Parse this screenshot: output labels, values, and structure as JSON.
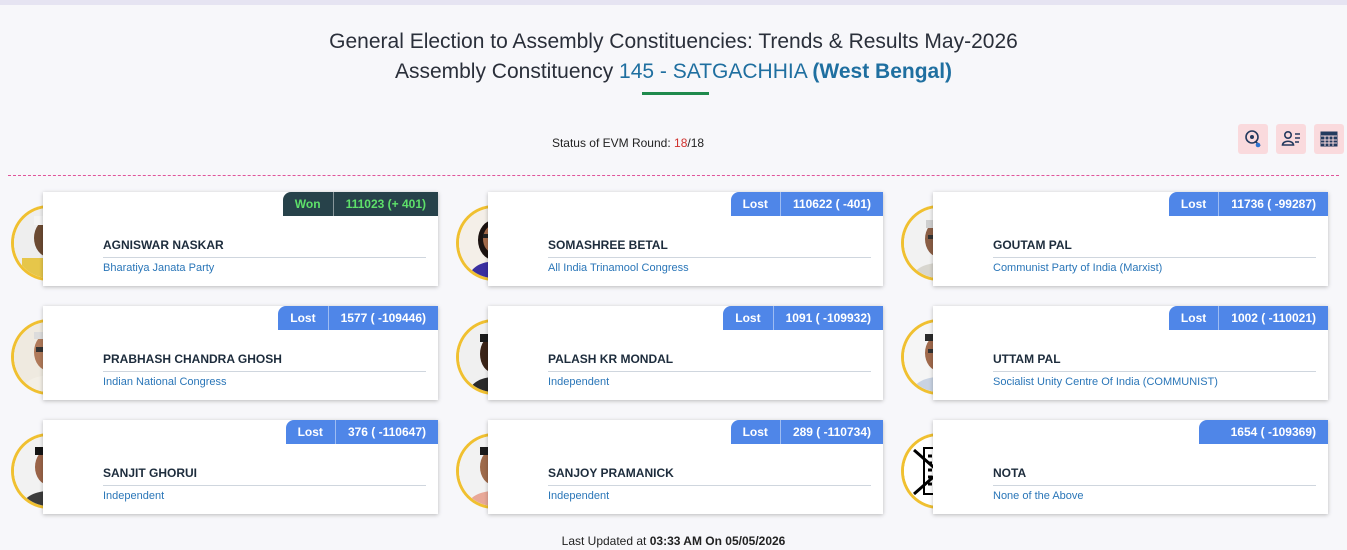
{
  "header": {
    "title_line1": "General Election to Assembly Constituencies: Trends & Results May-2026",
    "title_prefix": "Assembly Constituency",
    "constituency": "145 - SATGACHHIA",
    "state": "(West Bengal)"
  },
  "evm": {
    "label": "Status of EVM Round:",
    "current": "18",
    "total": "/18"
  },
  "tools": [
    {
      "icon": "map-pin-icon"
    },
    {
      "icon": "candidate-list-icon"
    },
    {
      "icon": "table-grid-icon"
    }
  ],
  "candidates": [
    {
      "name": "AGNISWAR NASKAR",
      "party": "Bharatiya Janata Party",
      "status": "Won",
      "votes": "111023 (+ 401)",
      "status_color": "#27424a"
    },
    {
      "name": "SOMASHREE BETAL",
      "party": "All India Trinamool Congress",
      "status": "Lost",
      "votes": "110622 ( -401)",
      "status_color": "#4f86e8"
    },
    {
      "name": "GOUTAM PAL",
      "party": "Communist Party of India (Marxist)",
      "status": "Lost",
      "votes": "11736 ( -99287)",
      "status_color": "#4f86e8"
    },
    {
      "name": "PRABHASH CHANDRA GHOSH",
      "party": "Indian National Congress",
      "status": "Lost",
      "votes": "1577 ( -109446)",
      "status_color": "#4f86e8"
    },
    {
      "name": "PALASH KR MONDAL",
      "party": "Independent",
      "status": "Lost",
      "votes": "1091 ( -109932)",
      "status_color": "#4f86e8"
    },
    {
      "name": "UTTAM PAL",
      "party": "Socialist Unity Centre Of India (COMMUNIST)",
      "status": "Lost",
      "votes": "1002 ( -110021)",
      "status_color": "#4f86e8"
    },
    {
      "name": "SANJIT GHORUI",
      "party": "Independent",
      "status": "Lost",
      "votes": "376 ( -110647)",
      "status_color": "#4f86e8"
    },
    {
      "name": "SANJOY PRAMANICK",
      "party": "Independent",
      "status": "Lost",
      "votes": "289 ( -110734)",
      "status_color": "#4f86e8"
    },
    {
      "name": "NOTA",
      "party": "None of the Above",
      "status": "",
      "votes": "1654 ( -109369)",
      "status_color": "#4f86e8"
    }
  ],
  "footer": {
    "label": "Last Updated at",
    "time": "03:33 AM On 05/05/2026"
  },
  "colors": {
    "accent": "#1f6fa0",
    "won": "#5ee06a",
    "lost_badge": "#4f86e8",
    "divider": "#e0549a",
    "avatar_ring": "#f0c030"
  }
}
